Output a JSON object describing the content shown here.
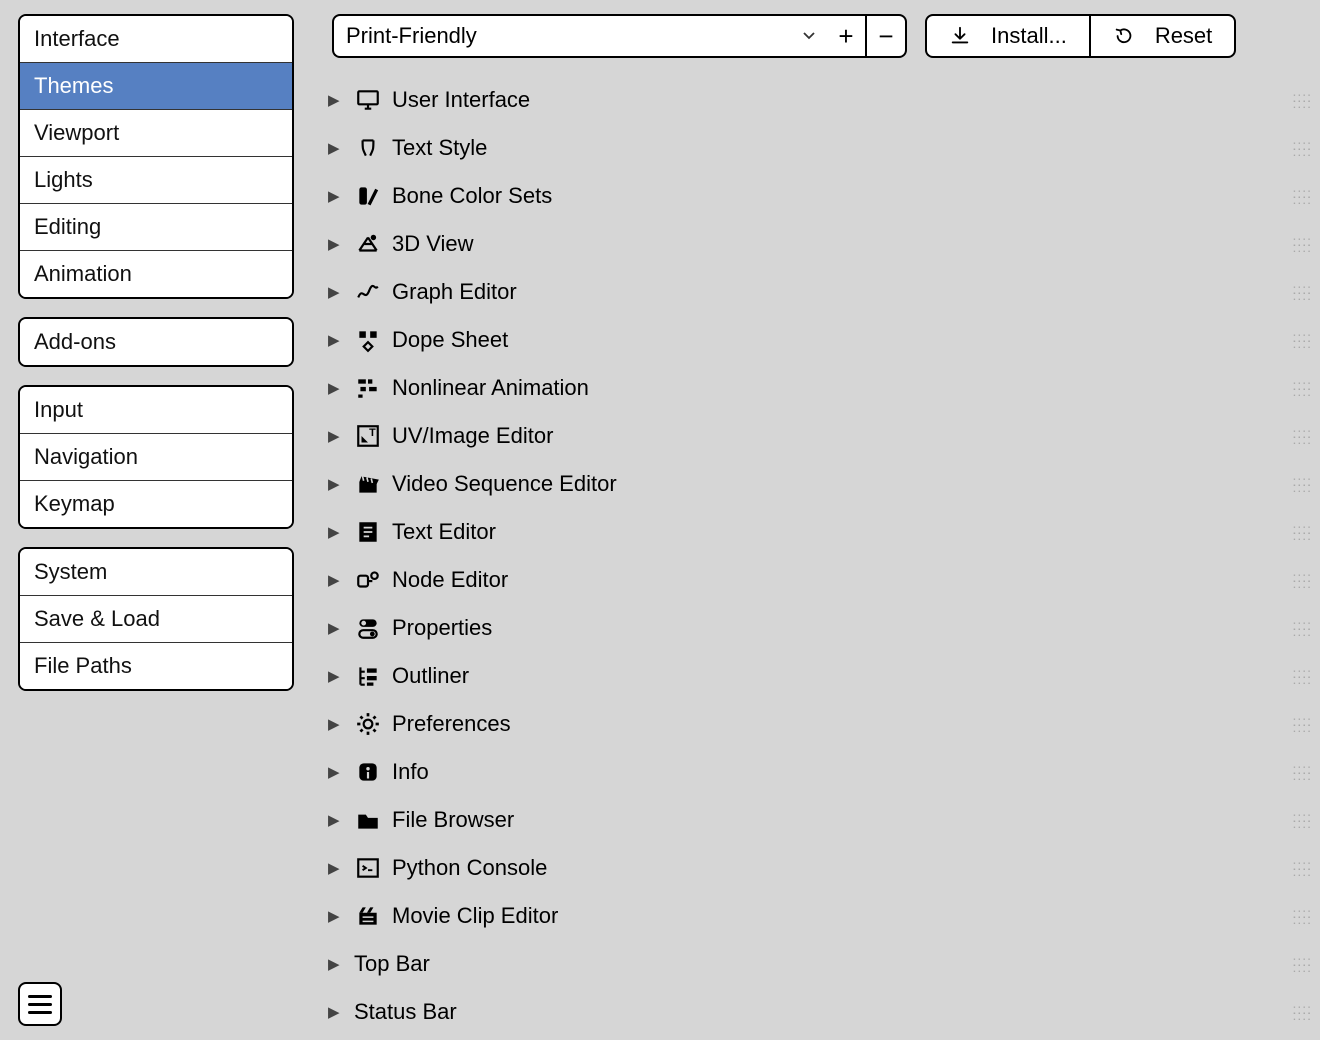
{
  "sidebar": {
    "groups": [
      {
        "items": [
          {
            "label": "Interface",
            "selected": false
          },
          {
            "label": "Themes",
            "selected": true
          },
          {
            "label": "Viewport",
            "selected": false
          },
          {
            "label": "Lights",
            "selected": false
          },
          {
            "label": "Editing",
            "selected": false
          },
          {
            "label": "Animation",
            "selected": false
          }
        ]
      },
      {
        "items": [
          {
            "label": "Add-ons",
            "selected": false
          }
        ]
      },
      {
        "items": [
          {
            "label": "Input",
            "selected": false
          },
          {
            "label": "Navigation",
            "selected": false
          },
          {
            "label": "Keymap",
            "selected": false
          }
        ]
      },
      {
        "items": [
          {
            "label": "System",
            "selected": false
          },
          {
            "label": "Save & Load",
            "selected": false
          },
          {
            "label": "File Paths",
            "selected": false
          }
        ]
      }
    ]
  },
  "toolbar": {
    "preset_label": "Print-Friendly",
    "add_label": "+",
    "remove_label": "−",
    "install_label": "Install...",
    "reset_label": "Reset"
  },
  "categories": [
    {
      "label": "User Interface",
      "icon": "monitor-icon",
      "has_handle": true
    },
    {
      "label": "Text Style",
      "icon": "text-icon",
      "has_handle": true
    },
    {
      "label": "Bone Color Sets",
      "icon": "palette-icon",
      "has_handle": true
    },
    {
      "label": "3D View",
      "icon": "viewport-icon",
      "has_handle": true
    },
    {
      "label": "Graph Editor",
      "icon": "graph-icon",
      "has_handle": true
    },
    {
      "label": "Dope Sheet",
      "icon": "dope-icon",
      "has_handle": true
    },
    {
      "label": "Nonlinear Animation",
      "icon": "nla-icon",
      "has_handle": true
    },
    {
      "label": "UV/Image Editor",
      "icon": "image-icon",
      "has_handle": true
    },
    {
      "label": "Video Sequence Editor",
      "icon": "clapper-icon",
      "has_handle": true
    },
    {
      "label": "Text Editor",
      "icon": "texteditor-icon",
      "has_handle": true
    },
    {
      "label": "Node Editor",
      "icon": "node-icon",
      "has_handle": true
    },
    {
      "label": "Properties",
      "icon": "properties-icon",
      "has_handle": true
    },
    {
      "label": "Outliner",
      "icon": "outliner-icon",
      "has_handle": true
    },
    {
      "label": "Preferences",
      "icon": "gear-icon",
      "has_handle": true
    },
    {
      "label": "Info",
      "icon": "info-icon",
      "has_handle": true
    },
    {
      "label": "File Browser",
      "icon": "folder-icon",
      "has_handle": true
    },
    {
      "label": "Python Console",
      "icon": "console-icon",
      "has_handle": true
    },
    {
      "label": "Movie Clip Editor",
      "icon": "movie-icon",
      "has_handle": true
    },
    {
      "label": "Top Bar",
      "icon": null,
      "has_handle": true
    },
    {
      "label": "Status Bar",
      "icon": null,
      "has_handle": true
    }
  ]
}
